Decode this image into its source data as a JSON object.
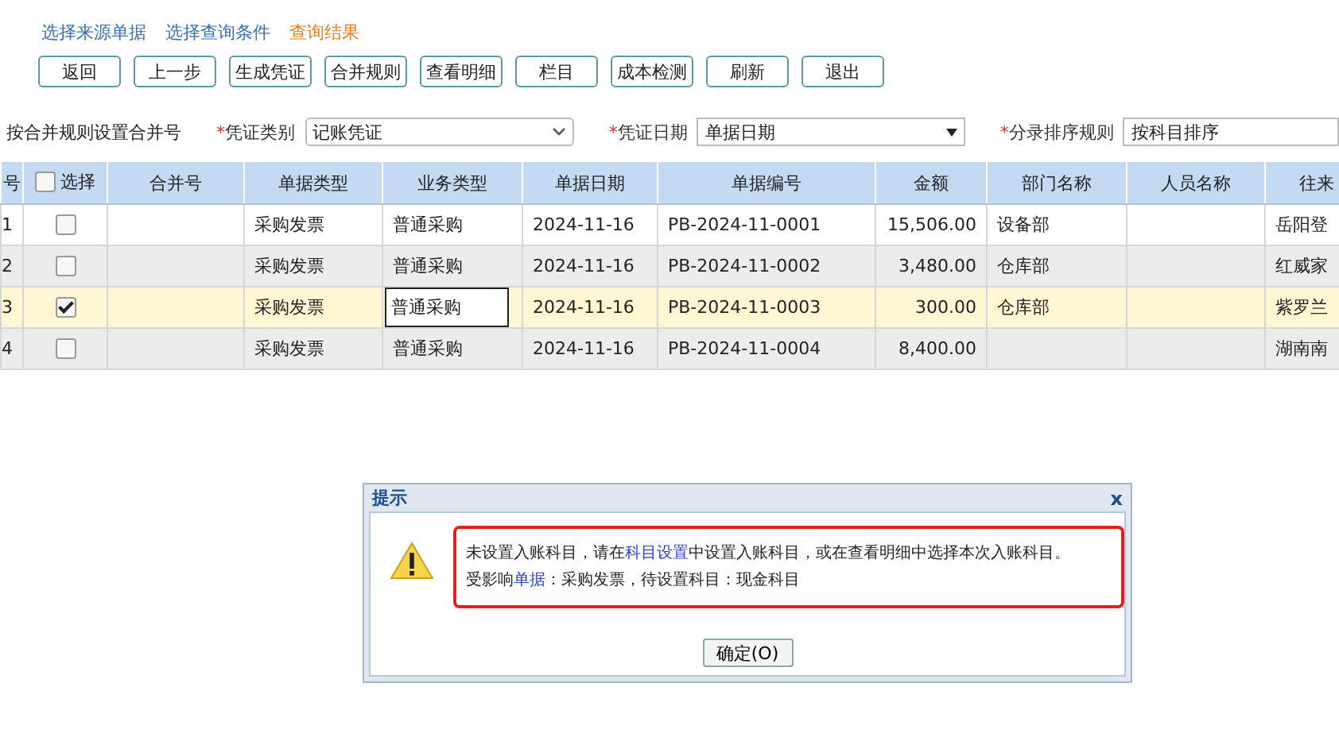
{
  "steps": [
    {
      "label": "选择来源单据",
      "selected": false
    },
    {
      "label": "选择查询条件",
      "selected": false
    },
    {
      "label": "查询结果",
      "selected": true
    }
  ],
  "toolbar": [
    "返回",
    "上一步",
    "生成凭证",
    "合并规则",
    "查看明细",
    "栏目",
    "成本检测",
    "刷新",
    "退出"
  ],
  "filters": {
    "merge_label": "按合并规则设置合并号",
    "fields": [
      {
        "label": "凭证类别",
        "marker": "*",
        "value": "记账凭证",
        "kind": "select"
      },
      {
        "label": "凭证日期",
        "marker": "*",
        "value": "单据日期",
        "kind": "combo"
      },
      {
        "label": "分录排序规则",
        "marker": "*",
        "value": "按科目排序",
        "kind": "text"
      }
    ]
  },
  "table": {
    "select_all_checked": false,
    "columns": [
      "号",
      "选择",
      "合并号",
      "单据类型",
      "业务类型",
      "单据日期",
      "单据编号",
      "金额",
      "部门名称",
      "人员名称",
      "往来"
    ],
    "rows": [
      {
        "cells": [
          "1",
          "",
          "",
          "采购发票",
          "普通采购",
          "2024-11-16",
          "PB-2024-11-0001",
          "15,506.00",
          "设备部",
          "",
          "岳阳登"
        ],
        "checked": false,
        "selected": false,
        "editing": false
      },
      {
        "cells": [
          "2",
          "",
          "",
          "采购发票",
          "普通采购",
          "2024-11-16",
          "PB-2024-11-0002",
          "3,480.00",
          "仓库部",
          "",
          "红威家"
        ],
        "checked": false,
        "selected": false,
        "editing": false
      },
      {
        "cells": [
          "3",
          "",
          "",
          "采购发票",
          "普通采购",
          "2024-11-16",
          "PB-2024-11-0003",
          "300.00",
          "仓库部",
          "",
          "紫罗兰"
        ],
        "checked": true,
        "selected": true,
        "editing": true
      },
      {
        "cells": [
          "4",
          "",
          "",
          "采购发票",
          "普通采购",
          "2024-11-16",
          "PB-2024-11-0004",
          "8,400.00",
          "",
          "",
          "湖南南"
        ],
        "checked": false,
        "selected": false,
        "editing": false
      }
    ]
  },
  "dialog": {
    "title": "提示",
    "close": "x",
    "highlighted": true,
    "lines": [
      [
        {
          "kind": "text",
          "text": "未设置入账科目，请在"
        },
        {
          "kind": "link",
          "text": "科目设置"
        },
        {
          "kind": "text",
          "text": "中设置入账科目，或在查看明细中选择本次入账科目。"
        }
      ],
      [
        {
          "kind": "text",
          "text": "受影响"
        },
        {
          "kind": "link",
          "text": "单据"
        },
        {
          "kind": "text",
          "text": "：采购发票，待设置科目：现金科目"
        }
      ]
    ],
    "button": "确定(O)"
  }
}
